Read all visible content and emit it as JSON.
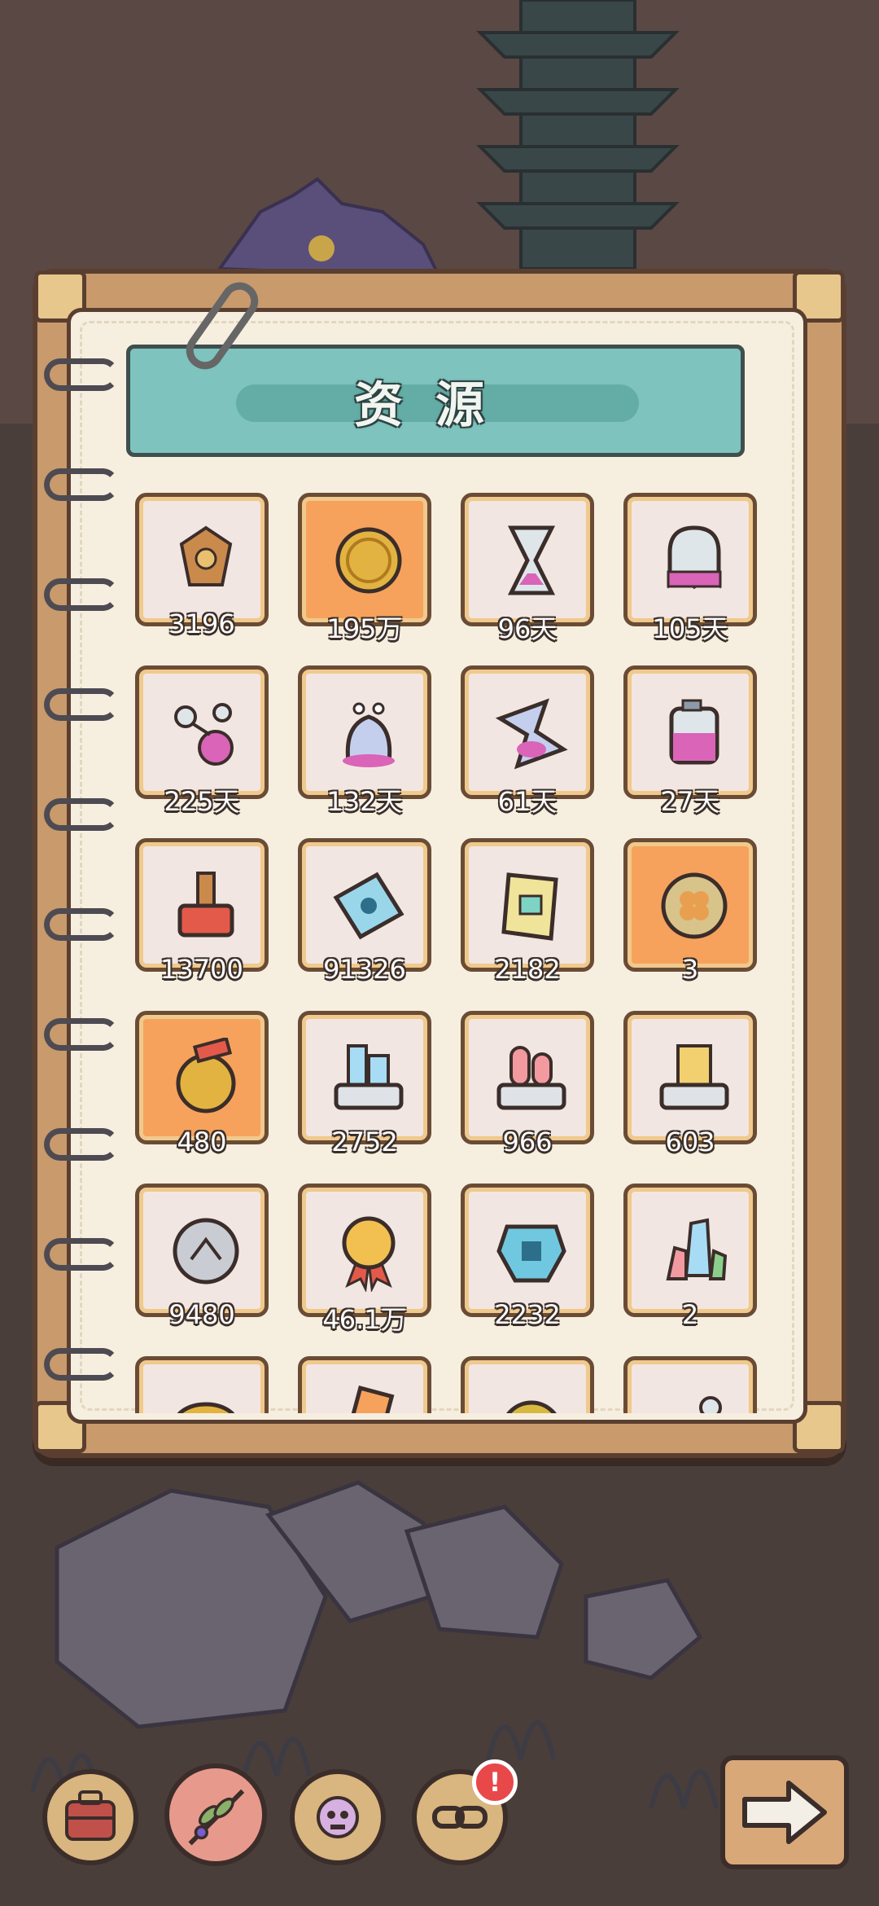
{
  "title": "资源",
  "colors": {
    "accent": "#f6a25c",
    "banner": "#7ec3bd",
    "paper": "#f6efe0",
    "frame": "#c89a6c"
  },
  "resources": [
    {
      "icon": "dragon-emblem-icon",
      "count": "3196"
    },
    {
      "icon": "gold-coin-icon",
      "count": "195万",
      "highlighted": true
    },
    {
      "icon": "hourglass-icon",
      "count": "96天"
    },
    {
      "icon": "ghost-icon",
      "count": "105天"
    },
    {
      "icon": "molecule-flask-icon",
      "count": "225天"
    },
    {
      "icon": "slime-creature-icon",
      "count": "132天"
    },
    {
      "icon": "potion-funnel-icon",
      "count": "61天"
    },
    {
      "icon": "potion-jar-icon",
      "count": "27天"
    },
    {
      "icon": "stamp-icon",
      "count": "13700"
    },
    {
      "icon": "blue-ticket-icon",
      "count": "91326"
    },
    {
      "icon": "scroll-ticket-icon",
      "count": "2182"
    },
    {
      "icon": "clover-coin-icon",
      "count": "3",
      "highlighted": true
    },
    {
      "icon": "medal-coin-icon",
      "count": "480",
      "highlighted": true
    },
    {
      "icon": "ice-crystal-tray-icon",
      "count": "2752"
    },
    {
      "icon": "pink-gem-tray-icon",
      "count": "966"
    },
    {
      "icon": "gold-bar-tray-icon",
      "count": "603"
    },
    {
      "icon": "silver-coin-icon",
      "count": "9480"
    },
    {
      "icon": "award-ribbon-icon",
      "count": "46.1万"
    },
    {
      "icon": "blue-shield-icon",
      "count": "2232"
    },
    {
      "icon": "crystal-cluster-icon",
      "count": "2"
    },
    {
      "icon": "gold-ring-icon",
      "count": ""
    },
    {
      "icon": "card-icon",
      "count": ""
    },
    {
      "icon": "gold-orb-icon",
      "count": ""
    },
    {
      "icon": "key-icon",
      "count": ""
    }
  ],
  "bottom_bar": [
    {
      "icon": "backpack-icon"
    },
    {
      "icon": "herb-branch-icon"
    },
    {
      "icon": "gear-skull-icon"
    },
    {
      "icon": "chain-icon",
      "badge": "!"
    }
  ],
  "next_button": {
    "icon": "arrow-right-icon"
  }
}
